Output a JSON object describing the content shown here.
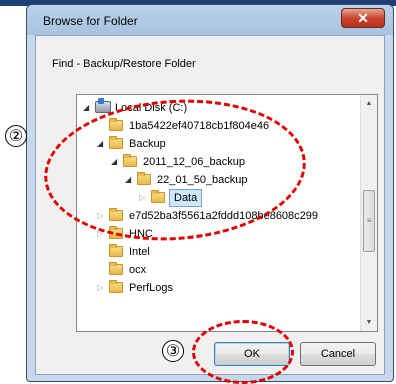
{
  "dialog": {
    "title": "Browse for Folder",
    "close_symbol": "✕",
    "description": "Find - Backup/Restore Folder",
    "ok_label": "OK",
    "cancel_label": "Cancel"
  },
  "tree": [
    {
      "label": "Local Disk (C:)",
      "icon": "drive-icon",
      "expander": "expanded"
    },
    {
      "label": "1ba5422ef40718cb1f804e46",
      "icon": "folder-icon",
      "expander": "none"
    },
    {
      "label": "Backup",
      "icon": "folder-icon",
      "expander": "expanded"
    },
    {
      "label": "2011_12_06_backup",
      "icon": "folder-icon",
      "expander": "expanded"
    },
    {
      "label": "22_01_50_backup",
      "icon": "folder-icon",
      "expander": "expanded"
    },
    {
      "label": "Data",
      "icon": "folder-icon",
      "expander": "collapsed",
      "selected": true
    },
    {
      "label": "e7d52ba3f5561a2fddd108be8608c299",
      "icon": "folder-icon",
      "expander": "collapsed"
    },
    {
      "label": "HNC",
      "icon": "folder-icon",
      "expander": "collapsed"
    },
    {
      "label": "Intel",
      "icon": "folder-icon",
      "expander": "none"
    },
    {
      "label": "ocx",
      "icon": "folder-icon",
      "expander": "none"
    },
    {
      "label": "PerfLogs",
      "icon": "folder-icon",
      "expander": "collapsed"
    }
  ],
  "annotations": {
    "marker_2": "②",
    "marker_3": "③",
    "color": "#e00000"
  }
}
